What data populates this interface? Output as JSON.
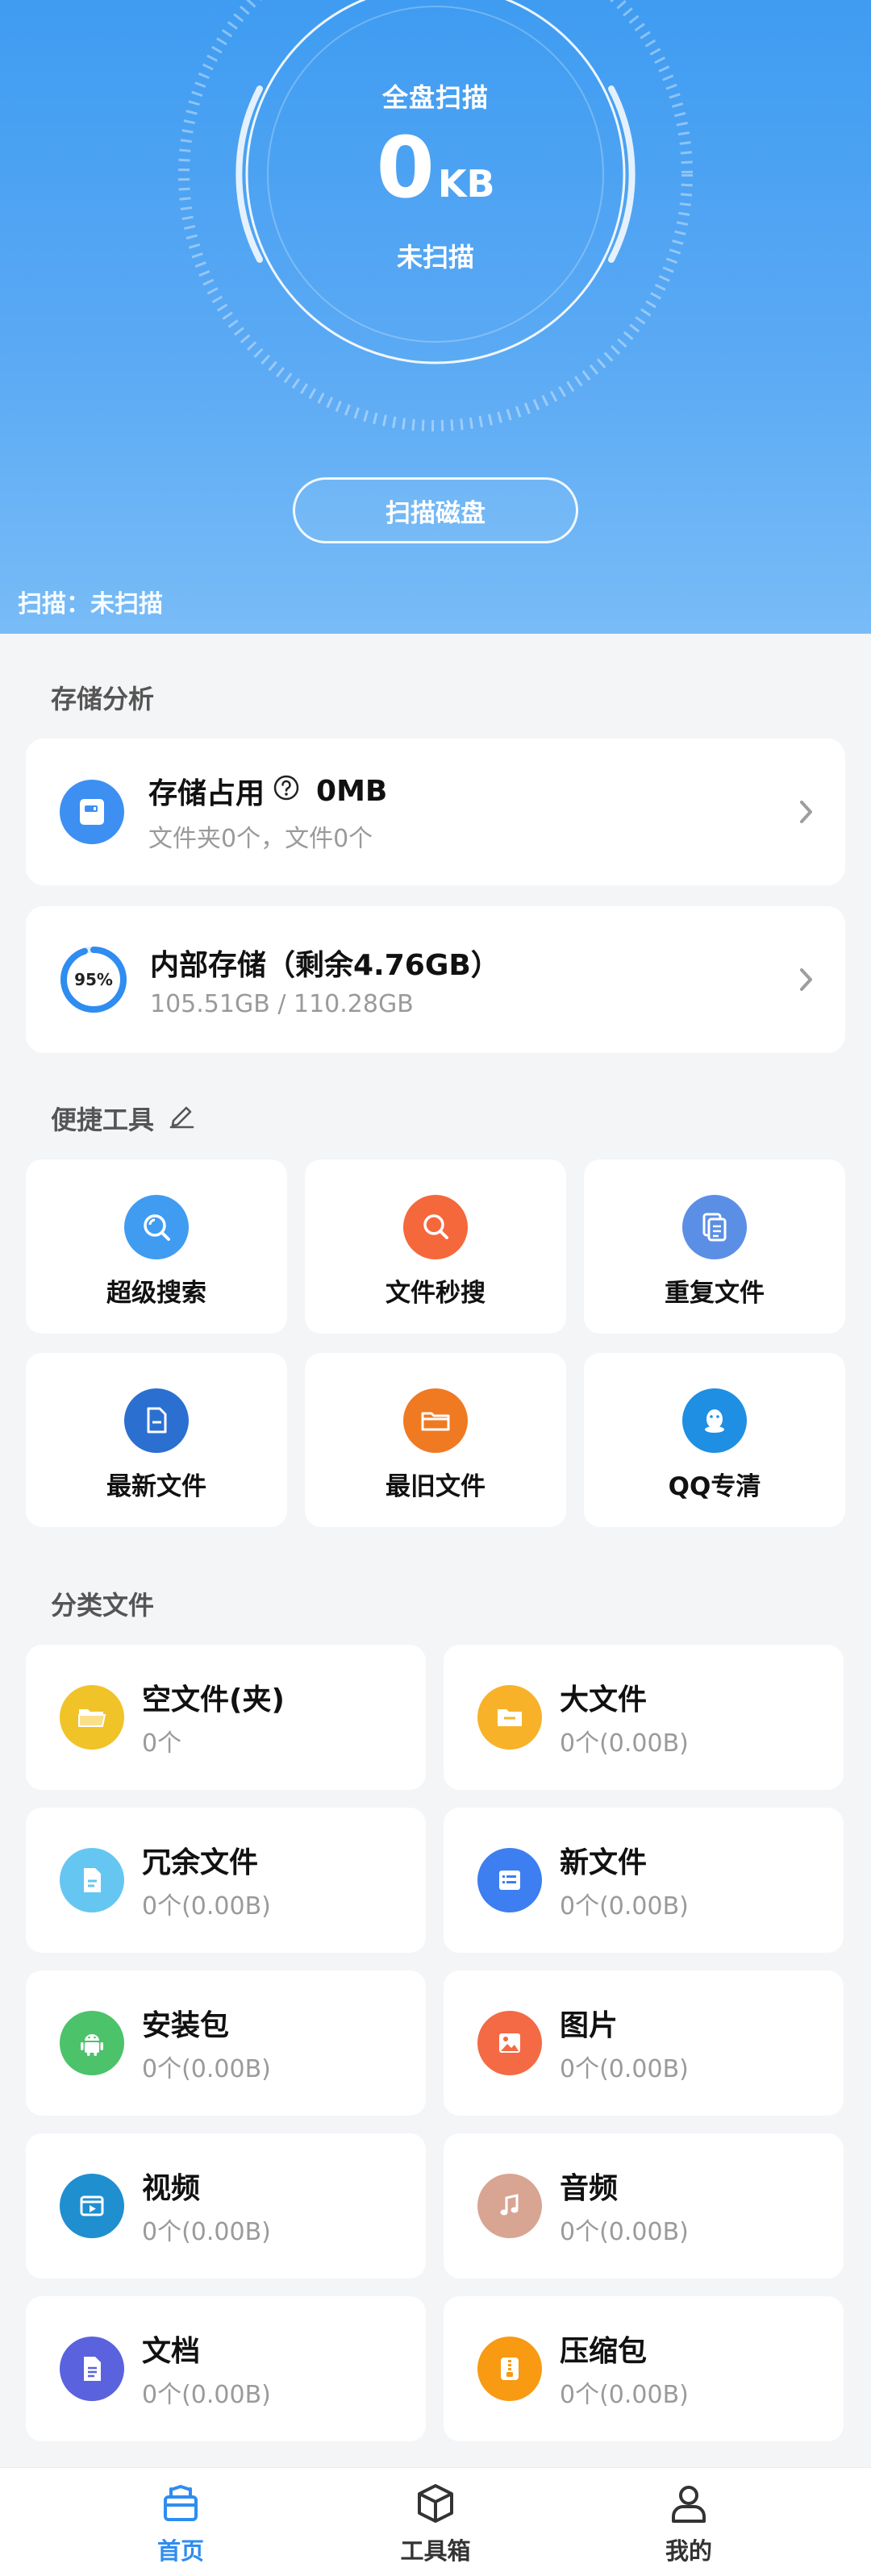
{
  "header": {
    "gauge_title": "全盘扫描",
    "gauge_value": "0",
    "gauge_unit": "KB",
    "gauge_status": "未扫描",
    "scan_button": "扫描磁盘",
    "scan_state": "扫描：未扫描"
  },
  "storage_analysis": {
    "title": "存储分析",
    "usage": {
      "label": "存储占用",
      "value": "0MB",
      "detail": "文件夹0个，文件0个",
      "icon": "disk-icon"
    },
    "internal": {
      "label": "内部存储（剩余4.76GB）",
      "detail": "105.51GB / 110.28GB",
      "percent_text": "95%",
      "percent": 95
    }
  },
  "quick_tools": {
    "title": "便捷工具",
    "items": [
      {
        "label": "超级搜索",
        "icon": "super-search-icon",
        "color": "#3f9cf1"
      },
      {
        "label": "文件秒搜",
        "icon": "file-search-icon",
        "color": "#f4683b"
      },
      {
        "label": "重复文件",
        "icon": "duplicate-file-icon",
        "color": "#5b8fe6"
      },
      {
        "label": "最新文件",
        "icon": "newest-file-icon",
        "color": "#2b6fd1"
      },
      {
        "label": "最旧文件",
        "icon": "oldest-folder-icon",
        "color": "#ef7a22"
      },
      {
        "label": "QQ专清",
        "icon": "qq-icon",
        "color": "#1e8fe2"
      }
    ]
  },
  "categories": {
    "title": "分类文件",
    "items": [
      {
        "name": "空文件(夹)",
        "stat": "0个",
        "icon": "empty-folder-icon",
        "color": "#f0c328"
      },
      {
        "name": "大文件",
        "stat": "0个(0.00B)",
        "icon": "big-file-icon",
        "color": "#f7b22a"
      },
      {
        "name": "冗余文件",
        "stat": "0个(0.00B)",
        "icon": "redundant-file-icon",
        "color": "#66c6f2"
      },
      {
        "name": "新文件",
        "stat": "0个(0.00B)",
        "icon": "new-file-icon",
        "color": "#3d7ef0"
      },
      {
        "name": "安装包",
        "stat": "0个(0.00B)",
        "icon": "android-icon",
        "color": "#4cc26b"
      },
      {
        "name": "图片",
        "stat": "0个(0.00B)",
        "icon": "image-icon",
        "color": "#f46a45"
      },
      {
        "name": "视频",
        "stat": "0个(0.00B)",
        "icon": "video-icon",
        "color": "#1f8fd0"
      },
      {
        "name": "音频",
        "stat": "0个(0.00B)",
        "icon": "music-icon",
        "color": "#d8a592"
      },
      {
        "name": "文档",
        "stat": "0个(0.00B)",
        "icon": "document-icon",
        "color": "#5a62dd"
      },
      {
        "name": "压缩包",
        "stat": "0个(0.00B)",
        "icon": "zip-icon",
        "color": "#f89a12"
      }
    ]
  },
  "nav": {
    "items": [
      {
        "label": "首页",
        "icon": "home-icon",
        "active": true
      },
      {
        "label": "工具箱",
        "icon": "toolbox-icon",
        "active": false
      },
      {
        "label": "我的",
        "icon": "profile-icon",
        "active": false
      }
    ],
    "active_color": "#2f8cf0",
    "inactive_color": "#333333"
  }
}
